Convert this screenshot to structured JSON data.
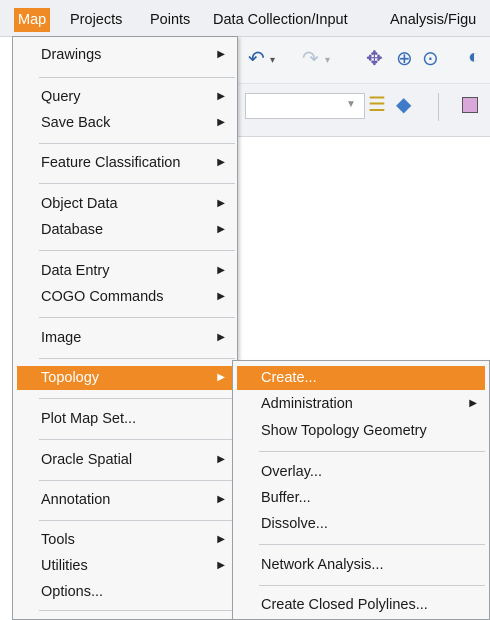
{
  "menubar": {
    "items": [
      "Map",
      "Projects",
      "Points",
      "Data Collection/Input",
      "Analysis/Figu"
    ]
  },
  "map_menu": {
    "drawings": "Drawings",
    "query": "Query",
    "save_back": "Save Back",
    "feature_classification": "Feature Classification",
    "object_data": "Object Data",
    "database": "Database",
    "data_entry": "Data Entry",
    "cogo_commands": "COGO Commands",
    "image": "Image",
    "topology": "Topology",
    "plot_map_set": "Plot Map Set...",
    "oracle_spatial": "Oracle Spatial",
    "annotation": "Annotation",
    "tools": "Tools",
    "utilities": "Utilities",
    "options": "Options..."
  },
  "topology_menu": {
    "create": "Create...",
    "administration": "Administration",
    "show_topology_geometry": "Show Topology Geometry",
    "overlay": "Overlay...",
    "buffer": "Buffer...",
    "dissolve": "Dissolve...",
    "network_analysis": "Network Analysis...",
    "create_closed_polylines": "Create Closed Polylines..."
  },
  "colors": {
    "highlight": "#f08a24",
    "menu_bg": "#f7f7f7"
  },
  "icons": [
    "undo-icon",
    "redo-icon",
    "layers-icon",
    "zoom-icon",
    "combo-dropdown-icon"
  ]
}
